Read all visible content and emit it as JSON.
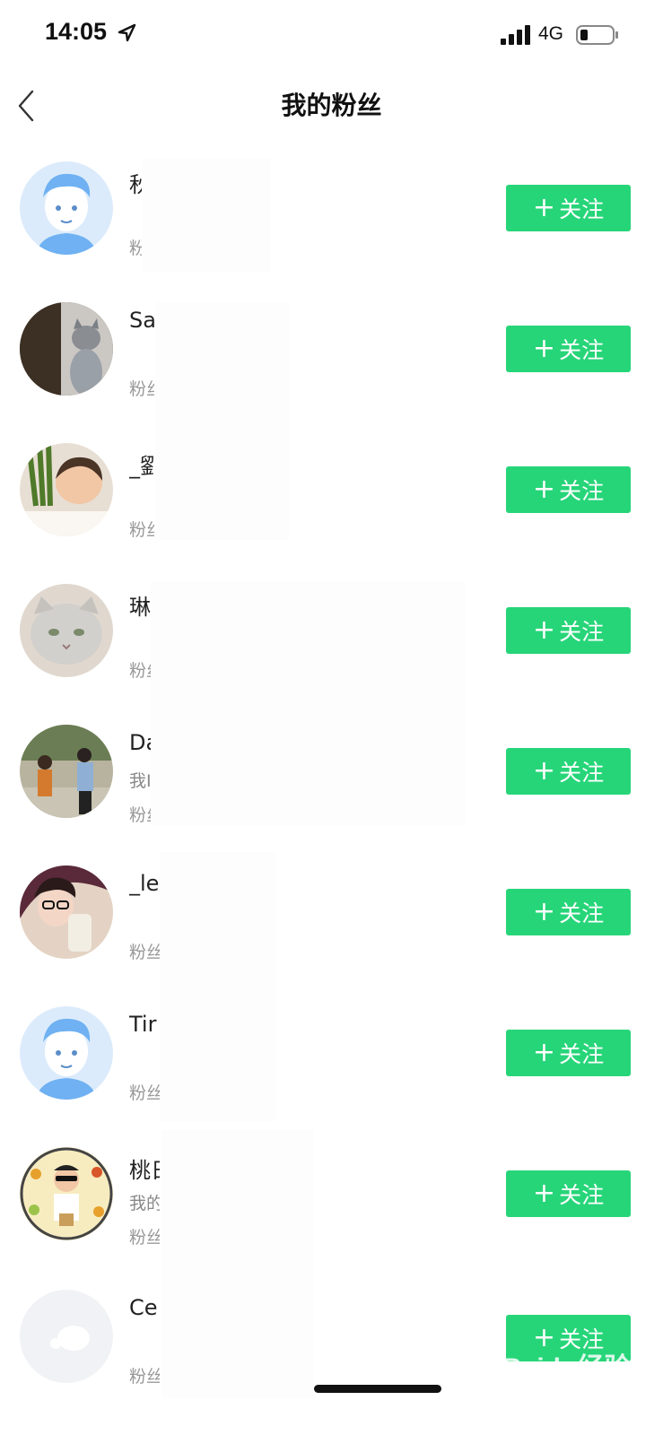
{
  "status_bar": {
    "time": "14:05",
    "network": "4G"
  },
  "nav": {
    "title": "我的粉丝"
  },
  "follow_label": "关注",
  "fans": [
    {
      "name": "秋",
      "bio": "",
      "count_label": "粉",
      "avatar": "default-avatar"
    },
    {
      "name": "Sa",
      "bio": "",
      "count_label": "粉丝",
      "avatar": "cat-photo"
    },
    {
      "name": "_劉",
      "bio": "",
      "count_label": "粉丝",
      "avatar": "baby-photo"
    },
    {
      "name": "琳",
      "bio": "",
      "count_label": "粉丝",
      "avatar": "white-cat-photo"
    },
    {
      "name": "Da",
      "bio": "我I",
      "count_label": "粉丝",
      "avatar": "couple-photo"
    },
    {
      "name": "_le",
      "bio": "",
      "count_label": "粉丝",
      "avatar": "girl-glasses-photo"
    },
    {
      "name": "Tir",
      "bio": "",
      "count_label": "粉丝",
      "avatar": "default-avatar"
    },
    {
      "name": "桃日",
      "bio": "我的",
      "count_label": "粉丝",
      "avatar": "boy-food-photo"
    },
    {
      "name": "Ce",
      "bio": "",
      "count_label": "粉丝",
      "avatar": "faded-avatar"
    }
  ],
  "watermark": "Baidu经验",
  "colors": {
    "follow_green": "#27d579",
    "text_primary": "#222222",
    "text_secondary": "#999999"
  }
}
